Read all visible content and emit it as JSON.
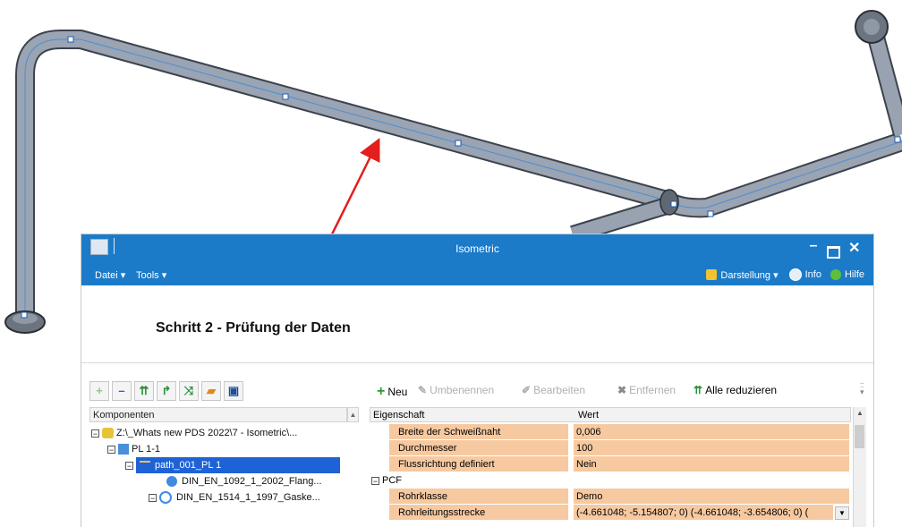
{
  "window": {
    "title": "Isometric",
    "menu": {
      "datei": "Datei ▾",
      "tools": "Tools ▾"
    },
    "right_menu": {
      "darstellung": "Darstellung ▾",
      "info": "Info",
      "hilfe": "Hilfe"
    },
    "controls": {
      "minimize": "–",
      "maximize": "□",
      "close": "✕"
    }
  },
  "header": {
    "step_title": "Schritt 2  - Prüfung der Daten"
  },
  "left_panel": {
    "toolbar": [
      "add-icon",
      "remove-icon",
      "expand-all-icon",
      "branch-icon",
      "reduce-icon",
      "folder-icon",
      "save-icon"
    ],
    "column_header": "Komponenten",
    "tree": [
      {
        "toggle": "□-",
        "label": "Z:\\_Whats new PDS 2022\\7 - Isometric\\...",
        "icon": "assembly-icon"
      },
      {
        "toggle": "□-",
        "label": "PL 1-1",
        "icon": "pipeline-icon"
      },
      {
        "toggle": "□-",
        "label": "path_001_PL 1",
        "icon": "path-icon",
        "selected": true
      },
      {
        "toggle": "",
        "label": "DIN_EN_1092_1_2002_Flang...",
        "icon": "flange-icon"
      },
      {
        "toggle": "□-",
        "label": "DIN_EN_1514_1_1997_Gaske...",
        "icon": "gasket-icon"
      }
    ]
  },
  "right_panel": {
    "toolbar": {
      "neu": "Neu",
      "umbenennen": "Umbenennen",
      "bearbeiten": "Bearbeiten",
      "entfernen": "Entfernen",
      "alle_reduzieren": "Alle reduzieren"
    },
    "columns": {
      "property": "Eigenschaft",
      "value": "Wert"
    },
    "rows": [
      {
        "property": "Breite der Schweißnaht",
        "value": "0,006"
      },
      {
        "property": "Durchmesser",
        "value": "100"
      },
      {
        "property": "Flussrichtung definiert",
        "value": "Nein"
      },
      {
        "property": "PCF",
        "value": ""
      },
      {
        "property": "Rohrklasse",
        "value": "Demo"
      },
      {
        "property": "Rohrleitungsstrecke",
        "value": "(-4.661048; -5.154807; 0)  (-4.661048; -3.654806; 0)  ("
      }
    ]
  },
  "colors": {
    "titlebar": "#1b7bc9",
    "highlight_row": "#f7c9a0",
    "selection": "#1e63d6",
    "annotation_arrow": "#e41d1d",
    "pipe": "#8f9aa8"
  }
}
